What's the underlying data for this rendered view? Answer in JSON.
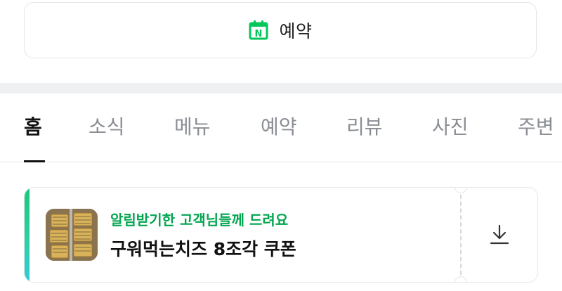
{
  "reserve_button": {
    "icon_letter": "N",
    "label": "예약",
    "icon_color": "#03c75a"
  },
  "tabs": [
    {
      "label": "홈",
      "active": true
    },
    {
      "label": "소식",
      "active": false
    },
    {
      "label": "메뉴",
      "active": false
    },
    {
      "label": "예약",
      "active": false
    },
    {
      "label": "리뷰",
      "active": false
    },
    {
      "label": "사진",
      "active": false
    },
    {
      "label": "주변",
      "active": false
    }
  ],
  "coupon": {
    "subtitle": "알림받기한 고객님들께 드려요",
    "title": "구워먹는치즈 8조각 쿠폰",
    "subtitle_color": "#03a550",
    "accent_color": "#19c87a",
    "thumbnail": "grilled-cheese-photo",
    "download_icon": "download-icon"
  }
}
